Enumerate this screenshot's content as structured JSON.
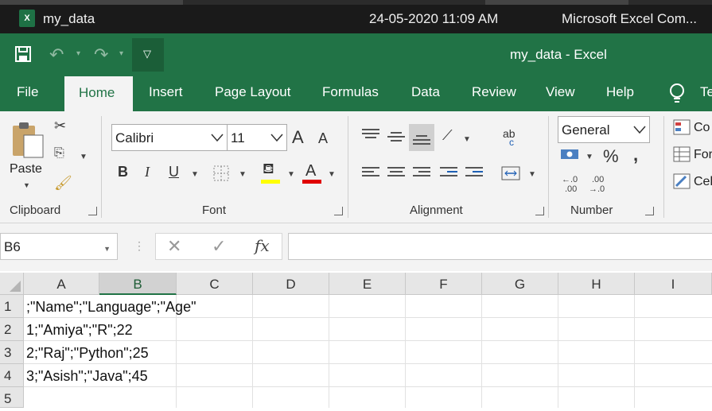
{
  "explorer": {
    "file_name": "my_data",
    "file_date": "24-05-2020 11:09 AM",
    "file_type": "Microsoft Excel Com..."
  },
  "titlebar": {
    "title": "my_data  -  Excel"
  },
  "tabs": [
    "File",
    "Home",
    "Insert",
    "Page Layout",
    "Formulas",
    "Data",
    "Review",
    "View",
    "Help",
    "Te"
  ],
  "ribbon": {
    "clipboard": {
      "paste_label": "Paste",
      "group_label": "Clipboard"
    },
    "font": {
      "font_name": "Calibri",
      "font_size": "11",
      "group_label": "Font",
      "grow": "A",
      "shrink": "A",
      "bold": "B",
      "italic": "I",
      "underline": "U",
      "font_color_letter": "A",
      "highlight_color": "#ffff00",
      "font_color": "#e00000"
    },
    "alignment": {
      "group_label": "Alignment",
      "wrap": "ab",
      "wrap2": "c"
    },
    "number": {
      "format": "General",
      "percent": "%",
      "comma": ",",
      "inc_decimal_top": "←.0",
      "inc_decimal_bottom": ".00",
      "dec_decimal_top": ".00",
      "dec_decimal_bottom": "→.0",
      "group_label": "Number"
    },
    "styles": {
      "cond_format": "Co",
      "format_table": "For",
      "cell_styles": "Cel"
    }
  },
  "formula_bar": {
    "name_box": "B6",
    "fx": "fx",
    "value": ""
  },
  "sheet": {
    "columns": [
      "A",
      "B",
      "C",
      "D",
      "E",
      "F",
      "G",
      "H",
      "I"
    ],
    "selected_column": "B",
    "rows": [
      {
        "num": "1",
        "A": ";\"Name\";\"Language\";\"Age\""
      },
      {
        "num": "2",
        "A": "1;\"Amiya\";\"R\";22"
      },
      {
        "num": "3",
        "A": "2;\"Raj\";\"Python\";25"
      },
      {
        "num": "4",
        "A": "3;\"Asish\";\"Java\";45"
      },
      {
        "num": "5",
        "A": ""
      }
    ]
  },
  "colors": {
    "excel_green": "#217346",
    "ribbon_bg": "#f3f3f3"
  }
}
